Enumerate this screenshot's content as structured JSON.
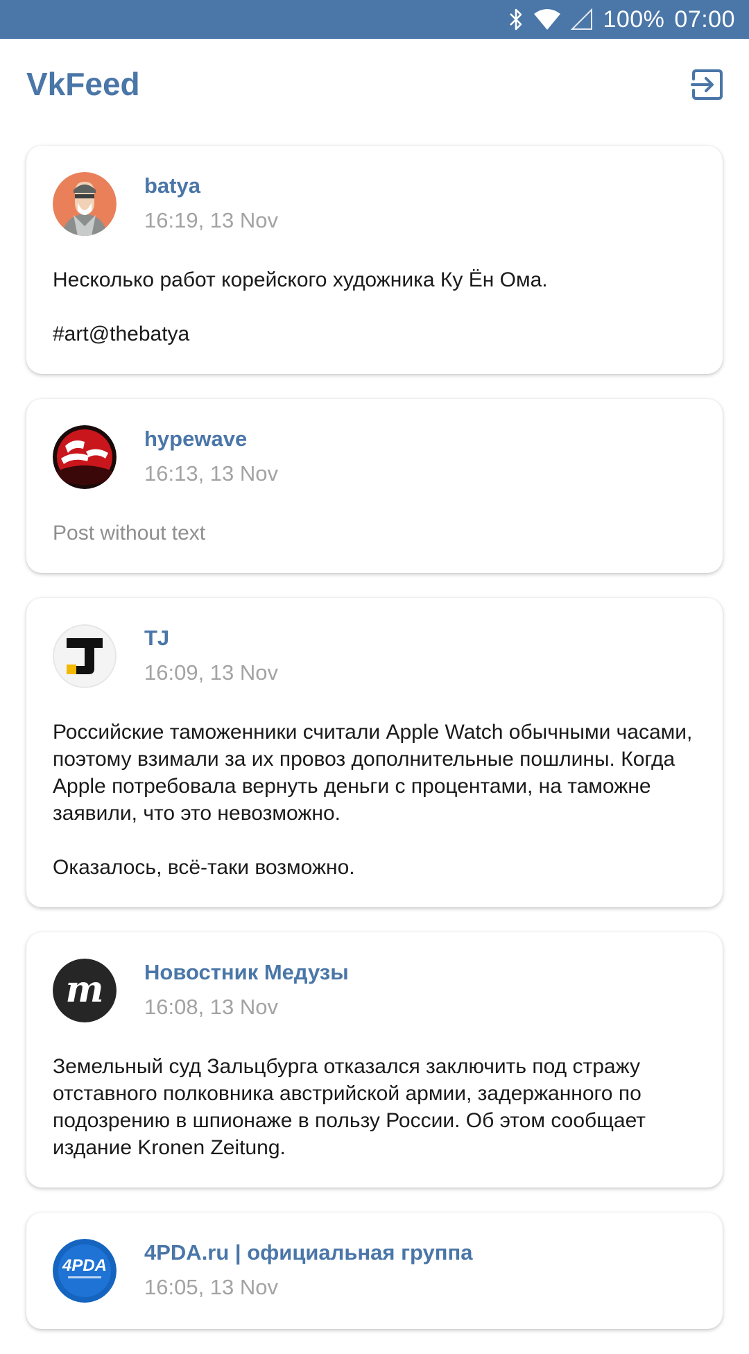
{
  "status_bar": {
    "icons": [
      "bluetooth-icon",
      "wifi-icon",
      "cell-signal-icon"
    ],
    "battery": "100%",
    "time": "07:00"
  },
  "app_bar": {
    "title": "VkFeed",
    "logout_icon": "logout-icon"
  },
  "colors": {
    "accent": "#4a76a8",
    "timestamp": "#a3a3a3",
    "placeholder_text": "#8f8f8f"
  },
  "posts": [
    {
      "author": "batya",
      "time": "16:19, 13 Nov",
      "avatar": "batya-avatar-icon",
      "text": "Несколько работ корейского художника Ку Ён Ома.\n\n#art@thebatya"
    },
    {
      "author": "hypewave",
      "time": "16:13, 13 Nov",
      "avatar": "hypewave-avatar-icon",
      "text": "Post without text"
    },
    {
      "author": "TJ",
      "time": "16:09, 13 Nov",
      "avatar": "tj-avatar-icon",
      "text": "Российские таможенники считали Apple Watch обычными часами, поэтому взимали за их провоз дополнительные пошлины. Когда Apple потребовала вернуть деньги с процентами, на таможне заявили, что это невозможно.\n\nОказалось, всё-таки возможно."
    },
    {
      "author": "Новостник Медузы",
      "time": "16:08, 13 Nov",
      "avatar": "meduza-avatar-icon",
      "text": "Земельный суд Зальцбурга отказался заключить под стражу отставного полковника австрийской армии, задержанного по подозрению в шпионаже в пользу России. Об этом сообщает издание Kronen Zeitung."
    },
    {
      "author": "4PDA.ru | официальная группа",
      "time": "16:05, 13 Nov",
      "avatar": "4pda-avatar-icon",
      "text": ""
    }
  ]
}
